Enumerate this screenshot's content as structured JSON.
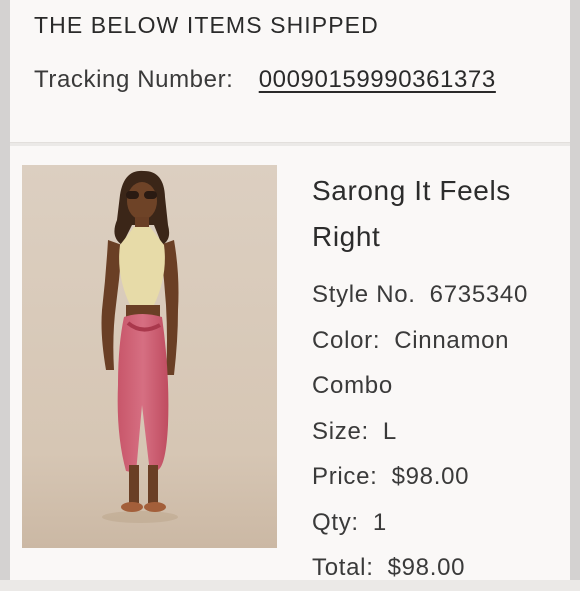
{
  "shipment": {
    "heading": "THE BELOW ITEMS SHIPPED",
    "tracking_label": "Tracking Number:",
    "tracking_number": "00090159990361373"
  },
  "product": {
    "name": "Sarong It Feels Right",
    "style_label": "Style No.",
    "style_value": "6735340",
    "color_label": "Color:",
    "color_value": "Cinnamon Combo",
    "size_label": "Size:",
    "size_value": "L",
    "price_label": "Price:",
    "price_value": "$98.00",
    "qty_label": "Qty:",
    "qty_value": "1",
    "total_label": "Total:",
    "total_value": "$98.00"
  }
}
